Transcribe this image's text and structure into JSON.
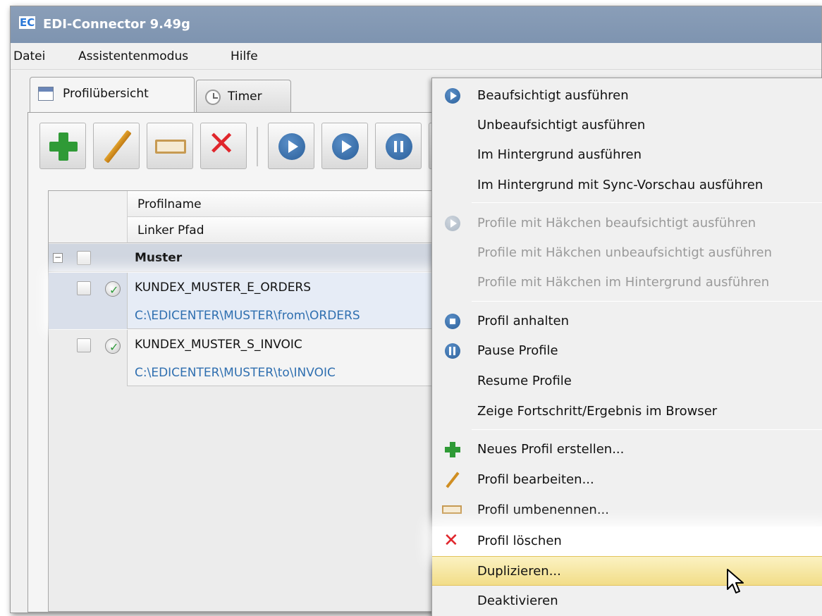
{
  "window": {
    "title": "EDI-Connector 9.49g",
    "logo": "EC"
  },
  "menubar": [
    "Datei",
    "Assistentenmodus",
    "Hilfe"
  ],
  "tabs": [
    {
      "label": "Profilübersicht",
      "icon": "calendar-icon",
      "active": true
    },
    {
      "label": "Timer",
      "icon": "clock-icon",
      "active": false
    }
  ],
  "toolbar": [
    {
      "name": "new-profile-button",
      "icon": "plus-icon"
    },
    {
      "name": "edit-profile-button",
      "icon": "pencil-icon"
    },
    {
      "name": "rename-profile-button",
      "icon": "rename-icon"
    },
    {
      "name": "delete-profile-button",
      "icon": "x-icon"
    },
    {
      "name": "run-supervised-button",
      "icon": "play-icon"
    },
    {
      "name": "run-unsupervised-button",
      "icon": "play-outline-icon"
    },
    {
      "name": "pause-button",
      "icon": "pause-icon"
    }
  ],
  "grid": {
    "columns": [
      "Profilname",
      "Linker Pfad"
    ],
    "group": "Muster",
    "rows": [
      {
        "name": "KUNDEX_MUSTER_E_ORDERS",
        "path": "C:\\EDICENTER\\MUSTER\\from\\ORDERS"
      },
      {
        "name": "KUNDEX_MUSTER_S_INVOIC",
        "path": "C:\\EDICENTER\\MUSTER\\to\\INVOIC"
      }
    ]
  },
  "context_menu": {
    "items": [
      {
        "label": "Beaufsichtigt ausführen",
        "icon": "play-icon",
        "enabled": true
      },
      {
        "label": "Unbeaufsichtigt ausführen",
        "icon": "",
        "enabled": true
      },
      {
        "label": "Im Hintergrund ausführen",
        "icon": "",
        "enabled": true
      },
      {
        "label": "Im Hintergrund mit Sync-Vorschau ausführen",
        "icon": "",
        "enabled": true
      },
      {
        "label": "Profile mit Häkchen beaufsichtigt ausführen",
        "icon": "play-icon",
        "enabled": false
      },
      {
        "label": "Profile mit Häkchen unbeaufsichtigt ausführen",
        "icon": "",
        "enabled": false
      },
      {
        "label": "Profile mit Häkchen im Hintergrund ausführen",
        "icon": "",
        "enabled": false
      },
      {
        "label": "Profil anhalten",
        "icon": "stop-icon",
        "enabled": true
      },
      {
        "label": "Pause Profile",
        "icon": "pause-icon",
        "enabled": true
      },
      {
        "label": "Resume Profile",
        "icon": "",
        "enabled": true
      },
      {
        "label": "Zeige Fortschritt/Ergebnis im Browser",
        "icon": "",
        "enabled": true
      },
      {
        "label": "Neues Profil erstellen...",
        "icon": "plus-icon",
        "enabled": true
      },
      {
        "label": "Profil bearbeiten...",
        "icon": "pencil-icon",
        "enabled": true
      },
      {
        "label": "Profil umbenennen...",
        "icon": "rename-icon",
        "enabled": true
      },
      {
        "label": "Profil löschen",
        "icon": "x-icon",
        "enabled": true
      },
      {
        "label": "Duplizieren...",
        "icon": "",
        "enabled": true,
        "highlighted": true
      },
      {
        "label": "Deaktivieren",
        "icon": "",
        "enabled": true
      }
    ]
  },
  "colors": {
    "titlebar": "#8a9eb8",
    "menu_highlight": "#f2dd88",
    "path_text": "#2f6fb0",
    "accent_green": "#2f9a36",
    "accent_red": "#e0262c"
  }
}
